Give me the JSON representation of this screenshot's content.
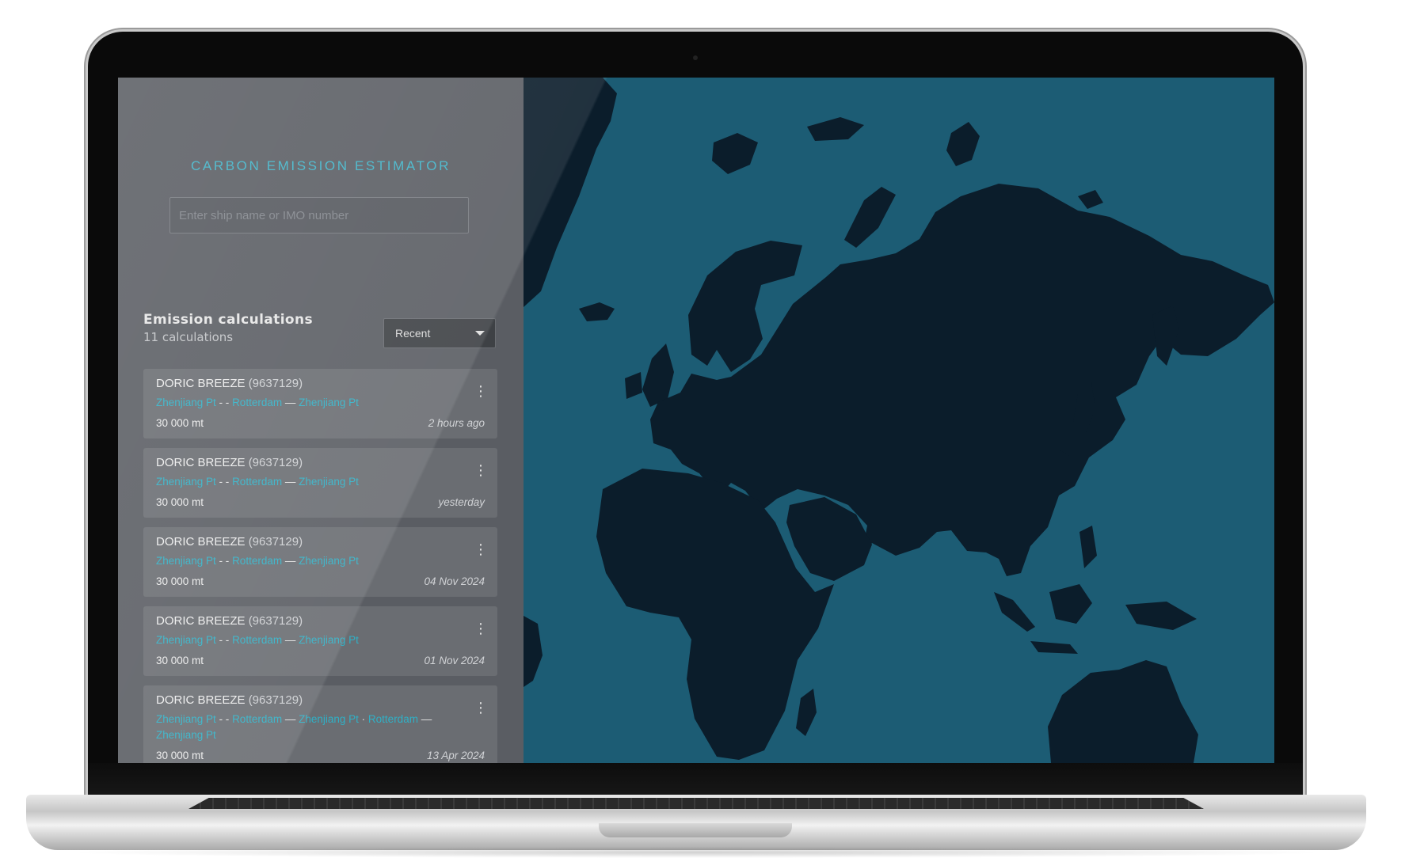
{
  "app": {
    "title": "CARBON EMISSION ESTIMATOR",
    "search_placeholder": "Enter ship name or IMO number"
  },
  "list": {
    "title": "Emission calculations",
    "count": "11 calculations",
    "sort_label": "Recent"
  },
  "calculations": [
    {
      "ship": "DORIC BREEZE",
      "imo": "(9637129)",
      "route": [
        {
          "port": "Zhenjiang Pt",
          "sep": " - - "
        },
        {
          "port": "Rotterdam",
          "sep": " — "
        },
        {
          "port": "Zhenjiang Pt",
          "sep": ""
        }
      ],
      "amount": "30 000 mt",
      "when": "2 hours ago"
    },
    {
      "ship": "DORIC BREEZE",
      "imo": "(9637129)",
      "route": [
        {
          "port": "Zhenjiang Pt",
          "sep": " - - "
        },
        {
          "port": "Rotterdam",
          "sep": " — "
        },
        {
          "port": "Zhenjiang Pt",
          "sep": ""
        }
      ],
      "amount": "30 000 mt",
      "when": "yesterday"
    },
    {
      "ship": "DORIC BREEZE",
      "imo": "(9637129)",
      "route": [
        {
          "port": "Zhenjiang Pt",
          "sep": " - - "
        },
        {
          "port": "Rotterdam",
          "sep": " — "
        },
        {
          "port": "Zhenjiang Pt",
          "sep": ""
        }
      ],
      "amount": "30 000 mt",
      "when": "04 Nov 2024"
    },
    {
      "ship": "DORIC BREEZE",
      "imo": "(9637129)",
      "route": [
        {
          "port": "Zhenjiang Pt",
          "sep": " - - "
        },
        {
          "port": "Rotterdam",
          "sep": " — "
        },
        {
          "port": "Zhenjiang Pt",
          "sep": ""
        }
      ],
      "amount": "30 000 mt",
      "when": "01 Nov 2024"
    },
    {
      "ship": "DORIC BREEZE",
      "imo": "(9637129)",
      "route": [
        {
          "port": "Zhenjiang Pt",
          "sep": " - - "
        },
        {
          "port": "Rotterdam",
          "sep": " — "
        },
        {
          "port": "Zhenjiang Pt",
          "sep": " · "
        },
        {
          "port": "Rotterdam",
          "sep": " — "
        },
        {
          "port": "Zhenjiang Pt",
          "sep": ""
        }
      ],
      "amount": "30 000 mt",
      "when": "13 Apr 2024"
    }
  ],
  "colors": {
    "accent": "#2fb0c6",
    "sidebar": "#5a5d63",
    "card": "#6a6d72",
    "ocean": "#1c5c74",
    "land": "#0b1d2b"
  },
  "icons": {
    "sort_caret": "chevron-down-icon",
    "card_menu": "kebab-menu-icon"
  }
}
